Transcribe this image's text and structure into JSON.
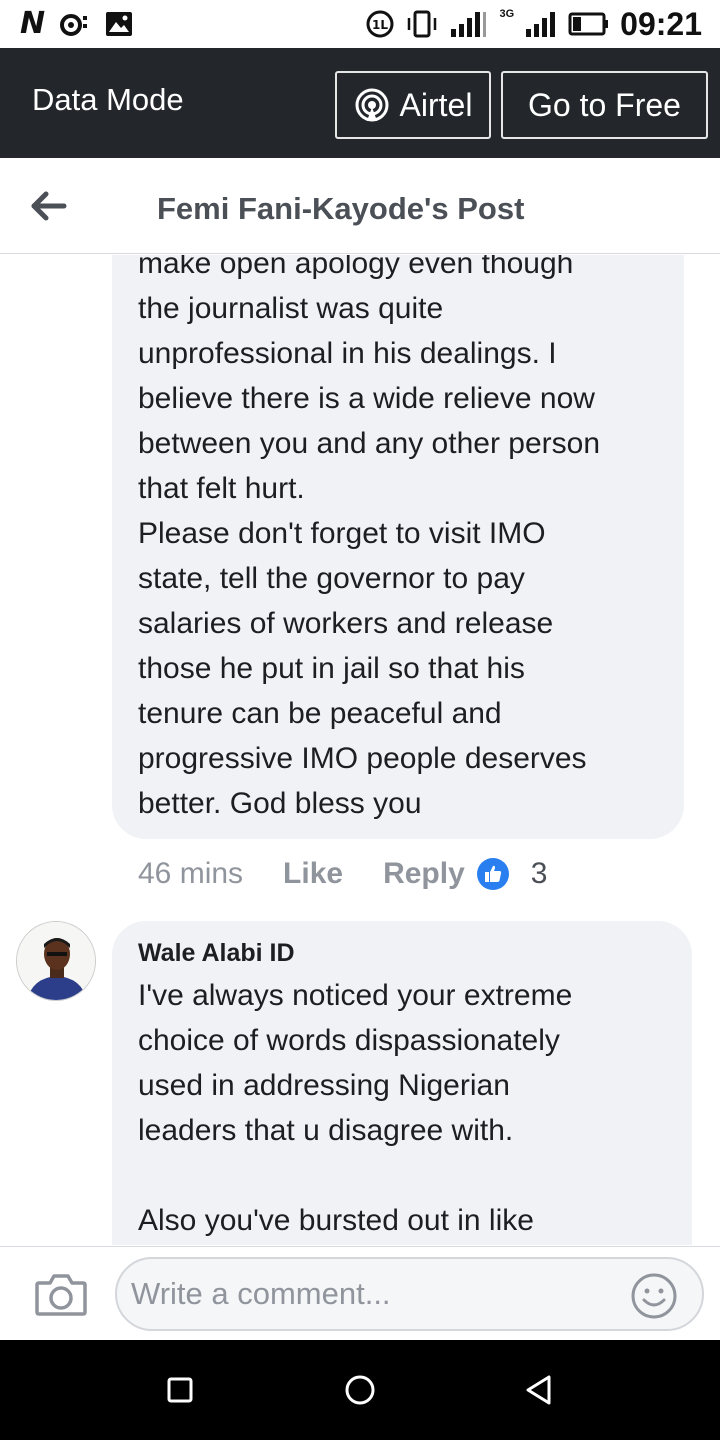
{
  "status_bar": {
    "carrier_icon_text": "N",
    "time": "09:21",
    "network_type": "3G"
  },
  "data_bar": {
    "title": "Data Mode",
    "airtel_label": "Airtel",
    "go_free_label": "Go to Free"
  },
  "header": {
    "title": "Femi Fani-Kayode's Post",
    "back_icon": "arrow-left-icon"
  },
  "comments": [
    {
      "text": "make open apology even though\nthe journalist was quite\nunprofessional in his dealings. I\nbelieve there is a wide relieve now\nbetween you and any other person\nthat felt hurt.\nPlease don't forget to visit  IMO\nstate, tell the governor to pay\nsalaries of workers and release\nthose he put in jail so that his\ntenure can be peaceful and\nprogressive IMO people deserves\nbetter. God bless you",
      "time": "46 mins",
      "like_label": "Like",
      "reply_label": "Reply",
      "reaction_count": "3"
    },
    {
      "author": "Wale Alabi ID",
      "text": "I've always noticed your extreme\nchoice of words dispassionately\nused in addressing Nigerian\nleaders that u disagree with.\n\nAlso you've bursted out in like"
    }
  ],
  "composer": {
    "placeholder": "Write a comment..."
  },
  "colors": {
    "data_bar_bg": "#23272c",
    "bubble_bg": "#f1f2f6",
    "like_blue": "#2a7ff0",
    "meta_gray": "#90949c"
  }
}
